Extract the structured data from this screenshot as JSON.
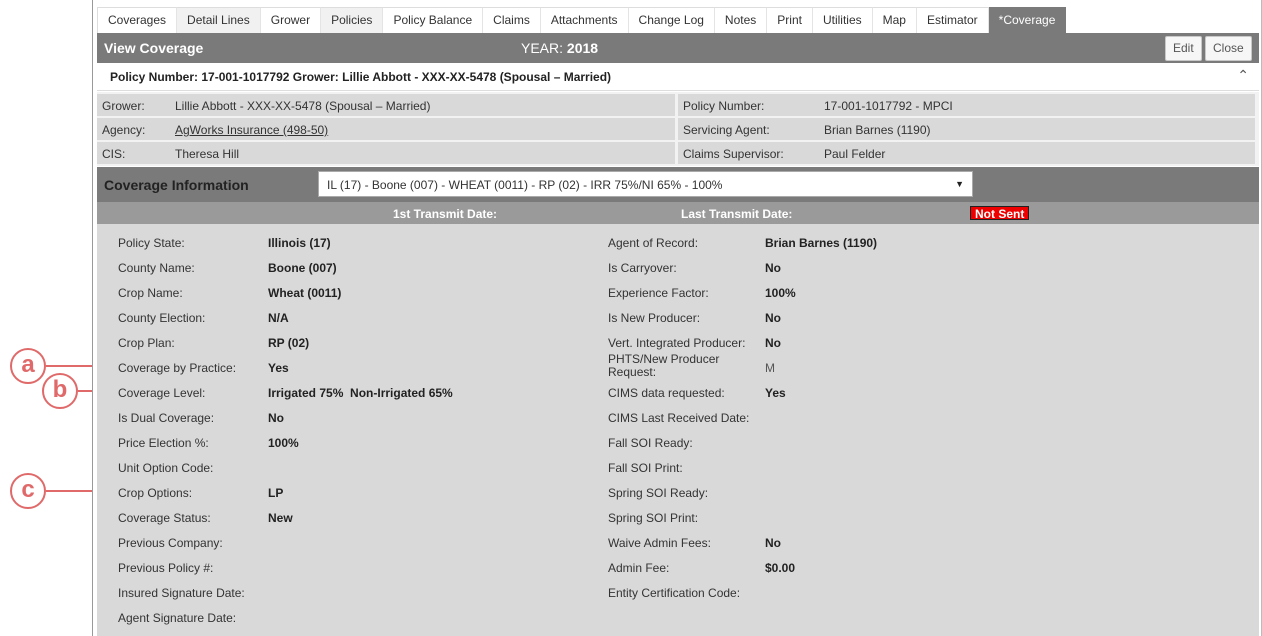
{
  "tabs": [
    "Coverages",
    "Detail Lines",
    "Grower",
    "Policies",
    "Policy Balance",
    "Claims",
    "Attachments",
    "Change Log",
    "Notes",
    "Print",
    "Utilities",
    "Map",
    "Estimator",
    "*Coverage"
  ],
  "titlebar": {
    "title": "View Coverage",
    "year_label": "YEAR:",
    "year": "2018",
    "edit": "Edit",
    "close": "Close"
  },
  "policy_header": "Policy Number: 17-001-1017792 Grower: Lillie Abbott - XXX-XX-5478 (Spousal – Married)",
  "info": {
    "grower_label": "Grower:",
    "grower": "Lillie Abbott - XXX-XX-5478 (Spousal – Married)",
    "policy_number_label": "Policy Number:",
    "policy_number": "17-001-1017792 - MPCI",
    "agency_label": "Agency:",
    "agency": "AgWorks Insurance (498-50)",
    "servicing_agent_label": "Servicing Agent:",
    "servicing_agent": "Brian Barnes (1190)",
    "cis_label": "CIS:",
    "cis": "Theresa Hill",
    "claims_supervisor_label": "Claims Supervisor:",
    "claims_supervisor": "Paul Felder"
  },
  "coverage": {
    "title": "Coverage Information",
    "selected": "IL (17) - Boone (007) - WHEAT (0011) - RP (02) - IRR 75%/NI 65% - 100%",
    "first_transmit_label": "1st Transmit Date:",
    "last_transmit_label": "Last Transmit Date:",
    "status": "Not Sent"
  },
  "left_fields": [
    {
      "label": "Policy State:",
      "value": "Illinois (17)"
    },
    {
      "label": "County Name:",
      "value": "Boone (007)"
    },
    {
      "label": "Crop Name:",
      "value": "Wheat (0011)"
    },
    {
      "label": "County Election:",
      "value": "N/A"
    },
    {
      "label": "Crop Plan:",
      "value": "RP (02)"
    },
    {
      "label": "Coverage by Practice:",
      "value": "Yes"
    },
    {
      "label": "Coverage Level:",
      "value": "Irrigated 75%  Non-Irrigated 65%"
    },
    {
      "label": "Is Dual Coverage:",
      "value": "No"
    },
    {
      "label": "Price Election %:",
      "value": "100%"
    },
    {
      "label": "Unit Option Code:",
      "value": ""
    },
    {
      "label": "Crop Options:",
      "value": "LP"
    },
    {
      "label": "Coverage Status:",
      "value": "New"
    },
    {
      "label": "Previous Company:",
      "value": ""
    },
    {
      "label": "Previous Policy #:",
      "value": ""
    },
    {
      "label": "Insured Signature Date:",
      "value": ""
    },
    {
      "label": "Agent Signature Date:",
      "value": ""
    }
  ],
  "right_fields": [
    {
      "label": "Agent of Record:",
      "value": "Brian Barnes (1190)"
    },
    {
      "label": "Is Carryover:",
      "value": "No"
    },
    {
      "label": "Experience Factor:",
      "value": "100%"
    },
    {
      "label": "Is New Producer:",
      "value": "No"
    },
    {
      "label": "Vert. Integrated Producer:",
      "value": "No"
    },
    {
      "label": "PHTS/New Producer Request:",
      "value": "M"
    },
    {
      "label": "CIMS data requested:",
      "value": "Yes"
    },
    {
      "label": "CIMS Last Received Date:",
      "value": ""
    },
    {
      "label": "Fall SOI Ready:",
      "value": ""
    },
    {
      "label": "Fall SOI Print:",
      "value": ""
    },
    {
      "label": "Spring SOI Ready:",
      "value": ""
    },
    {
      "label": "Spring SOI Print:",
      "value": ""
    },
    {
      "label": "Waive Admin Fees:",
      "value": "No"
    },
    {
      "label": "Admin Fee:",
      "value": "$0.00"
    },
    {
      "label": "Entity Certification Code:",
      "value": ""
    }
  ],
  "callouts": [
    "a",
    "b",
    "c"
  ],
  "colors": {
    "header_gray": "#7a7a7a",
    "panel_gray": "#d9d9d9",
    "callout_red": "#e06a6a",
    "not_sent_red": "#ee0000"
  }
}
